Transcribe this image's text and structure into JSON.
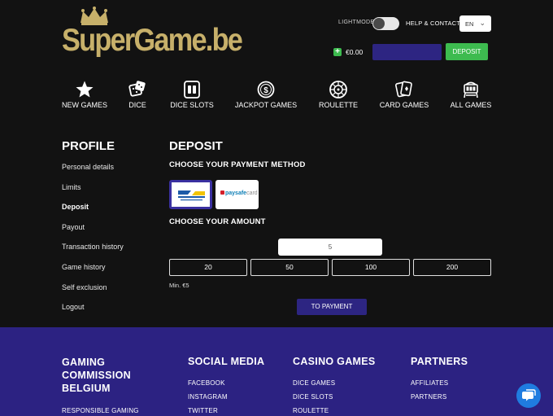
{
  "brand": {
    "name": "SuperGame.be"
  },
  "header": {
    "lightmode_label": "LIGHTMODE",
    "help_label": "HELP & CONTACT",
    "language": "EN",
    "balance": "€0.00",
    "deposit_label": "DEPOSIT"
  },
  "nav": [
    {
      "label": "NEW GAMES",
      "icon": "star-icon"
    },
    {
      "label": "DICE",
      "icon": "dice-icon"
    },
    {
      "label": "DICE SLOTS",
      "icon": "dice-slots-icon"
    },
    {
      "label": "JACKPOT GAMES",
      "icon": "jackpot-icon"
    },
    {
      "label": "ROULETTE",
      "icon": "roulette-icon"
    },
    {
      "label": "CARD GAMES",
      "icon": "cards-icon"
    },
    {
      "label": "ALL GAMES",
      "icon": "slot-machine-icon"
    }
  ],
  "profile": {
    "title": "PROFILE",
    "items": [
      {
        "label": "Personal details",
        "active": false
      },
      {
        "label": "Limits",
        "active": false
      },
      {
        "label": "Deposit",
        "active": true
      },
      {
        "label": "Payout",
        "active": false
      },
      {
        "label": "Transaction history",
        "active": false
      },
      {
        "label": "Game history",
        "active": false
      },
      {
        "label": "Self exclusion",
        "active": false
      },
      {
        "label": "Logout",
        "active": false
      }
    ]
  },
  "deposit": {
    "title": "DEPOSIT",
    "method_heading": "CHOOSE YOUR PAYMENT METHOD",
    "methods": [
      {
        "name": "Bancontact",
        "selected": true
      },
      {
        "name": "paysafecard",
        "selected": false
      }
    ],
    "paysafe_text_a": "paysafe",
    "paysafe_text_b": "card",
    "amount_heading": "CHOOSE YOUR AMOUNT",
    "amount_value": "5",
    "presets": [
      "20",
      "50",
      "100",
      "200"
    ],
    "min_note": "Min. €5",
    "submit_label": "TO PAYMENT"
  },
  "footer": {
    "columns": [
      {
        "heading": "GAMING COMMISSION BELGIUM",
        "links": [
          "RESPONSIBLE GAMING"
        ]
      },
      {
        "heading": "SOCIAL MEDIA",
        "links": [
          "FACEBOOK",
          "INSTAGRAM",
          "TWITTER"
        ]
      },
      {
        "heading": "CASINO GAMES",
        "links": [
          "DICE GAMES",
          "DICE SLOTS",
          "ROULETTE"
        ]
      },
      {
        "heading": "PARTNERS",
        "links": [
          "AFFILIATES",
          "PARTNERS"
        ]
      }
    ],
    "gcb_line1": "GAMING",
    "gcb_line2": "COMMISSION",
    "gcb_line3": "BELGIUM"
  },
  "colors": {
    "background": "#121212",
    "brand_gold": "#c7b06a",
    "accent_purple": "#2d2582",
    "footer_purple": "#2c2282",
    "green": "#3dbb4f",
    "chat_blue": "#1f7ce0"
  }
}
